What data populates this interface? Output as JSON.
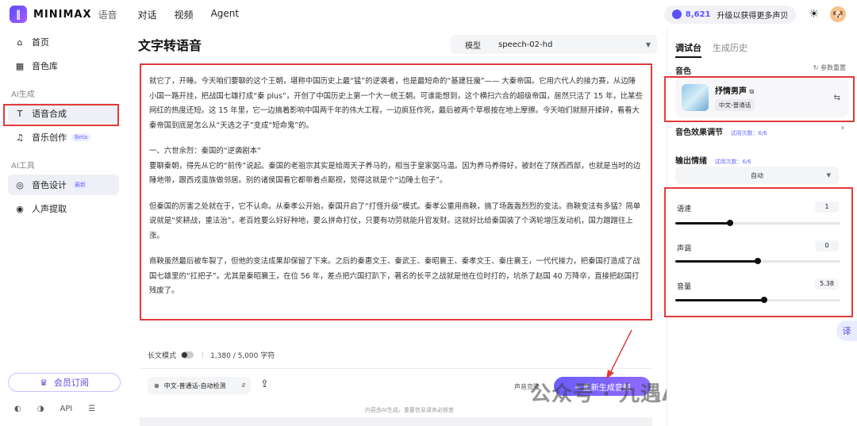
{
  "topbar": {
    "logo_mark": "‖",
    "logo_text": "MINIMAX",
    "logo_sub": "语音",
    "nav": [
      "对话",
      "视频",
      "Agent"
    ],
    "credits": "8,621",
    "credits_text": "升级以获得更多声贝",
    "sun_icon": "☀",
    "avatar": "🐶"
  },
  "sidebar": {
    "items": [
      {
        "icon": "⌂",
        "label": "首页"
      },
      {
        "icon": "▦",
        "label": "音色库"
      }
    ],
    "section_ai_gen": "AI生成",
    "gen_items": [
      {
        "icon": "T",
        "label": "语音合成"
      },
      {
        "icon": "♫",
        "label": "音乐创作",
        "badge": "Beta"
      }
    ],
    "section_ai_tools": "AI工具",
    "tool_items": [
      {
        "icon": "◎",
        "label": "音色设计",
        "badge": "最新"
      },
      {
        "icon": "◉",
        "label": "人声提取"
      }
    ],
    "member_button": "会员订阅",
    "footer": {
      "discord": "◐",
      "wechat": "◑",
      "api": "API",
      "more": "☰"
    }
  },
  "main": {
    "title": "文字转语音",
    "model_label": "模型",
    "model_value": "speech-02-hd",
    "paragraphs": [
      "就它了，开睡。今天咱们要聊的这个王朝，堪称中国历史上最“猛”的逆袭者，也是最短命的“基建狂魔”—— 大秦帝国。它用六代人的接力赛，从边陲小国一路开挂，把战国七雄打成“秦 plus”，开创了中国历史上第一个大一统王朝。可谁能想到，这个横扫六合的超级帝国，居然只活了 15 年，比某些网红的热度还短。这 15 年里，它一边搞着影响中国两千年的伟大工程，一边疯狂作死，最后被两个草根按在地上摩擦。今天咱们就掰开揉碎，看看大秦帝国到底是怎么从“天选之子”变成“短命鬼”的。",
      "一、六世余烈：秦国的“逆袭剧本”\n要聊秦朝，得先从它的“前传”说起。秦国的老祖宗其实是给周天子养马的，相当于皇家弼马温。因为养马养得好，被封在了陕西西部，也就是当时的边陲地带，跟西戎蛮族做邻居。别的诸侯国看它都带着点鄙视，觉得这就是个“边陲土包子”。",
      "但秦国的厉害之处就在于，它不认命。从秦孝公开始，秦国开启了“打怪升级”模式。秦孝公重用商鞅，搞了场轰轰烈烈的变法。商鞅变法有多猛？简单说就是“奖耕战，重法治”，老百姓要么好好种地，要么拼命打仗，只要有功劳就能升官发财。这就好比给秦国装了个涡轮增压发动机，国力蹭蹭往上涨。",
      "商鞅虽然最后被车裂了，但他的变法成果却保留了下来。之后的秦惠文王、秦武王、秦昭襄王、秦孝文王、秦庄襄王，一代代接力，把秦国打造成了战国七雄里的“扛把子”。尤其是秦昭襄王，在位 56 年，差点把六国打趴下，著名的长平之战就是他在位时打的，坑杀了赵国 40 万降卒，直接把赵国打残废了。"
    ],
    "long_text_label": "长文模式",
    "char_count": "1,380 / 5,000 字符",
    "language": "中文-普通话-自动检测",
    "clone_text": "声音克隆",
    "generate_button": "✦ 重新生成音频",
    "disclaimer": "内容由AI生成，重要信息请务必核查",
    "watermark": "公众号 · 九遇AI学习笔记"
  },
  "panel": {
    "tab_active": "调试台",
    "tab_history": "生成历史",
    "voice_label": "音色",
    "reset": "↻ 参数重置",
    "voice_name": "抒情男声",
    "voice_tag": "中文-普通话",
    "effect_label": "音色效果调节",
    "effect_trial": "试用次数：6/6",
    "emotion_label": "输出情绪",
    "emotion_trial": "试用次数：6/6",
    "emotion_value": "自动",
    "speed_label": "语速",
    "speed_value": "1",
    "speed_pct": 0.33,
    "pitch_label": "声调",
    "pitch_value": "0",
    "pitch_pct": 0.5,
    "volume_label": "音量",
    "volume_value": "5.38",
    "volume_pct": 0.54,
    "translate_icon": "译"
  },
  "colors": {
    "accent": "#6c5cff",
    "highlight_box": "#e23a3a"
  }
}
